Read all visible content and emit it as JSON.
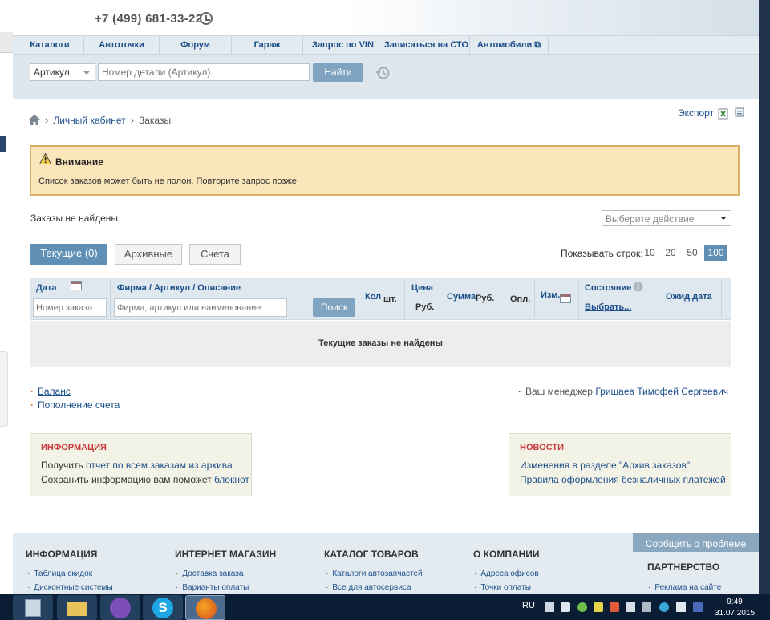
{
  "header": {
    "phone": "+7 (499) 681-33-22"
  },
  "nav": {
    "items": [
      {
        "label": "Каталоги",
        "w": 85
      },
      {
        "label": "Автоточки",
        "w": 94
      },
      {
        "label": "Форум",
        "w": 90
      },
      {
        "label": "Гараж",
        "w": 89
      },
      {
        "label": "Запрос по VIN",
        "w": 100
      },
      {
        "label": "Записаться на СТО",
        "w": 108
      },
      {
        "label": "Автомобили ⧉",
        "w": 98
      }
    ]
  },
  "search": {
    "type": "Артикул",
    "placeholder": "Номер детали (Артикул)",
    "button": "Найти"
  },
  "breadcrumb": {
    "account": "Личный кабинет",
    "current": "Заказы"
  },
  "export": "Экспорт",
  "alert": {
    "title": "Внимание",
    "text": "Список заказов может быть не полон. Повторите запрос позже"
  },
  "orders_status": "Заказы не найдены",
  "action_select": "Выберите действие",
  "tabs": {
    "current": "Текущие (0)",
    "archive": "Архивные",
    "bills": "Счета"
  },
  "rows": {
    "label": "Показывать строк:",
    "options": [
      "10",
      "20",
      "50",
      "100"
    ],
    "selected": "100"
  },
  "table": {
    "date": "Дата",
    "firm": "Фирма / Артикул / Описание",
    "qty": "Кол",
    "qty_unit": "шт.",
    "price": "Цена",
    "price_unit": "Руб.",
    "sum": "Сумма",
    "sum_unit": "Руб.",
    "paid": "Опл.",
    "changed": "Изм.",
    "state": "Состояние",
    "state_choose": "Выбрать...",
    "expected": "Ожид.дата",
    "order_placeholder": "Номер заказа",
    "firm_placeholder": "Фирма, артикул или наименование",
    "search_button": "Поиск",
    "empty": "Текущие заказы не найдены"
  },
  "links": {
    "balance": "Баланс",
    "topup": "Пополнение счета",
    "manager_prefix": "Ваш менеджер",
    "manager_name": "Гришаев Тимофей Сергеевич"
  },
  "info": {
    "title": "ИНФОРМАЦИЯ",
    "line1_prefix": "Получить",
    "line1_link": "отчет по всем заказам из архива",
    "line2_prefix": "Сохранить информацию вам поможет",
    "line2_link": "блокнот"
  },
  "news": {
    "title": "НОВОСТИ",
    "item1": "Изменения в разделе \"Архив заказов\"",
    "item2": "Правила оформления безналичных платежей"
  },
  "footer": {
    "report": "Сообщить о проблеме",
    "partner": "ПАРТНЕРСТВО",
    "partner_link": "Реклама на сайте",
    "columns": [
      {
        "title": "ИНФОРМАЦИЯ",
        "links": [
          "Таблица скидок",
          "Дисконтные системы"
        ]
      },
      {
        "title": "ИНТЕРНЕТ МАГАЗИН",
        "links": [
          "Доставка заказа",
          "Варианты оплаты"
        ]
      },
      {
        "title": "КАТАЛОГ ТОВАРОВ",
        "links": [
          "Каталоги автозапчастей",
          "Все для автосервиса"
        ]
      },
      {
        "title": "О КОМПАНИИ",
        "links": [
          "Адреса офисов",
          "Точки оплаты"
        ]
      }
    ]
  },
  "taskbar": {
    "lang": "RU",
    "time": "9:49",
    "date": "31.07.2015"
  },
  "colors": {
    "accent": "#5f8fb4",
    "link": "#1d4f8a",
    "alert_bg": "#fbe5bb",
    "alert_border": "#d8b063",
    "box_title": "#c83d3d"
  }
}
